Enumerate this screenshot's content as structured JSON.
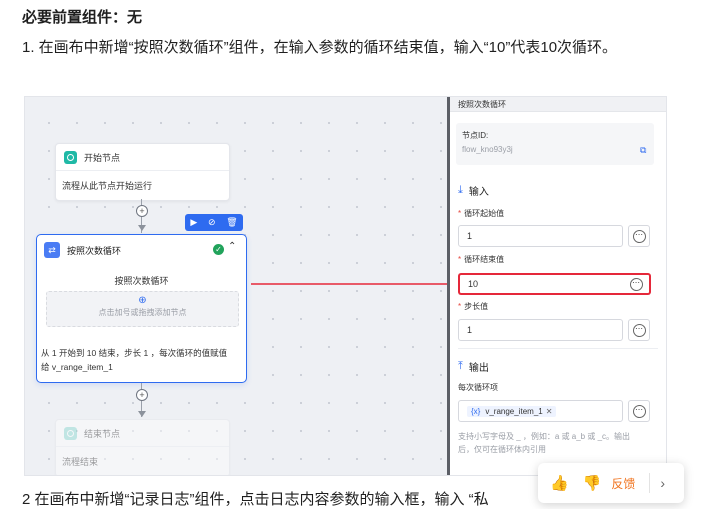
{
  "doc": {
    "required_components": "必要前置组件：无",
    "step1": "1. 在画布中新增“按照次数循环”组件，在输入参数的循环结束值，输入“10”代表10次循环。",
    "step2": "2 在画布中新增“记录日志”组件，点击日志内容参数的输入框，输入 “私"
  },
  "canvas": {
    "start_node": {
      "title": "开始节点",
      "desc": "流程从此节点开始运行"
    },
    "loop_node": {
      "title": "按照次数循环",
      "inner_title": "按照次数循环",
      "inner_hint": "点击加号或拖拽添加节点",
      "summary_line1": "从 1 开始到 10 结束，步长 1 ，每次循环的值赋值",
      "summary_line2": "给 v_range_item_1"
    },
    "end_node": {
      "title": "结束节点",
      "desc": "流程结束"
    }
  },
  "panel": {
    "header": "按照次数循环",
    "node_id_label": "节点ID:",
    "node_id_value": "flow_kno93y3j",
    "input_section": "输入",
    "loop_start_label": "循环起始值",
    "loop_start_value": "1",
    "loop_end_label": "循环结束值",
    "loop_end_value": "10",
    "step_label": "步长值",
    "step_value": "1",
    "output_section": "输出",
    "each_loop_label": "每次循环项",
    "var_tag": "v_range_item_1",
    "hint_line1": "支持小写字母及 _ ，例如：a 或 a_b 或 _c。输出",
    "hint_line2": "后，仅可在循环体内引用"
  },
  "feedback": {
    "dislike_label": "反馈"
  },
  "colors": {
    "accent": "#2e6bf0",
    "highlight": "#e5283a",
    "start": "#1fb9a6",
    "success": "#21a35b",
    "feedback": "#f0731e"
  }
}
